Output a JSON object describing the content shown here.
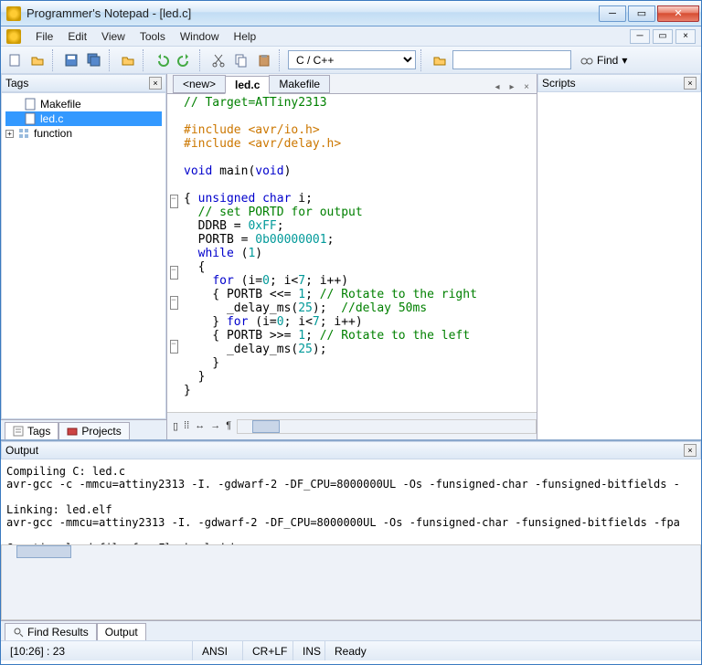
{
  "window": {
    "title": "Programmer's Notepad - [led.c]"
  },
  "menu": {
    "file": "File",
    "edit": "Edit",
    "view": "View",
    "tools": "Tools",
    "window": "Window",
    "help": "Help"
  },
  "toolbar": {
    "language": "C / C++",
    "search_placeholder": "",
    "find": "Find"
  },
  "tags_panel": {
    "title": "Tags",
    "items": [
      {
        "label": "Makefile",
        "kind": "file"
      },
      {
        "label": "led.c",
        "kind": "file",
        "active": true
      },
      {
        "label": "function",
        "kind": "group",
        "expandable": true
      }
    ],
    "tabs": {
      "tags": "Tags",
      "projects": "Projects"
    }
  },
  "scripts_panel": {
    "title": "Scripts"
  },
  "doc_tabs": {
    "new": "<new>",
    "current": "led.c",
    "makefile": "Makefile"
  },
  "code_lines": [
    {
      "fold": "",
      "text": "// Target=ATTiny2313",
      "cls": "c-comment"
    },
    {
      "fold": "",
      "text": ""
    },
    {
      "fold": "",
      "text": "#include <avr/io.h>",
      "cls": "c-preproc"
    },
    {
      "fold": "",
      "text": "#include <avr/delay.h>",
      "cls": "c-preproc"
    },
    {
      "fold": "",
      "text": ""
    },
    {
      "fold": "",
      "html": "<span class='c-keyword'>void</span> main(<span class='c-keyword'>void</span>)"
    },
    {
      "fold": "",
      "text": ""
    },
    {
      "fold": "-",
      "html": "{ <span class='c-keyword'>unsigned</span> <span class='c-keyword'>char</span> i;"
    },
    {
      "fold": "",
      "html": "  <span class='c-comment'>// set PORTD for output</span>"
    },
    {
      "fold": "",
      "html": "  DDRB = <span class='c-number'>0xFF</span>;"
    },
    {
      "fold": "",
      "html": "  PORTB = <span class='c-number'>0b00000001</span>;"
    },
    {
      "fold": "",
      "html": "  <span class='c-keyword'>while</span> (<span class='c-number'>1</span>)"
    },
    {
      "fold": "-",
      "text": "  {"
    },
    {
      "fold": "",
      "html": "    <span class='c-keyword'>for</span> (i=<span class='c-number'>0</span>; i&lt;<span class='c-number'>7</span>; i++)"
    },
    {
      "fold": "-",
      "html": "    { PORTB &lt;&lt;= <span class='c-number'>1</span>; <span class='c-comment'>// Rotate to the right</span>"
    },
    {
      "fold": "",
      "html": "      _delay_ms(<span class='c-number'>25</span>);  <span class='c-comment'>//delay 50ms</span>"
    },
    {
      "fold": "",
      "html": "    } <span class='c-keyword'>for</span> (i=<span class='c-number'>0</span>; i&lt;<span class='c-number'>7</span>; i++)"
    },
    {
      "fold": "-",
      "html": "    { PORTB &gt;&gt;= <span class='c-number'>1</span>; <span class='c-comment'>// Rotate to the left</span>"
    },
    {
      "fold": "",
      "html": "      _delay_ms(<span class='c-number'>25</span>);"
    },
    {
      "fold": "",
      "text": "    }"
    },
    {
      "fold": "",
      "text": "  }"
    },
    {
      "fold": "",
      "text": "}"
    }
  ],
  "output": {
    "title": "Output",
    "text": "Compiling C: led.c\navr-gcc -c -mmcu=attiny2313 -I. -gdwarf-2 -DF_CPU=8000000UL -Os -funsigned-char -funsigned-bitfields -\n\nLinking: led.elf\navr-gcc -mmcu=attiny2313 -I. -gdwarf-2 -DF_CPU=8000000UL -Os -funsigned-char -funsigned-bitfields -fpa\n\nCreating load file for Flash: led.hex\navr-objcopy -O ihex -R .eeprom -R .fuse -R .lock -R .signature led.elf led.hex\n\nCreating load file for EEPROM: led.eep\navr-objcopy -j .eeprom --set-section-flags=.eeprom=\"alloc,load\" \\\n    --change-section-lma .eeprom=0 --no-change-warnings -O ihex led.elf led.eep || exit 0\n\nCreating Extended Listing: led.lss",
    "tabs": {
      "find": "Find Results",
      "output": "Output"
    }
  },
  "statusbar": {
    "pos": "[10:26] : 23",
    "enc": "ANSI",
    "eol": "CR+LF",
    "mode": "INS",
    "msg": "Ready"
  }
}
